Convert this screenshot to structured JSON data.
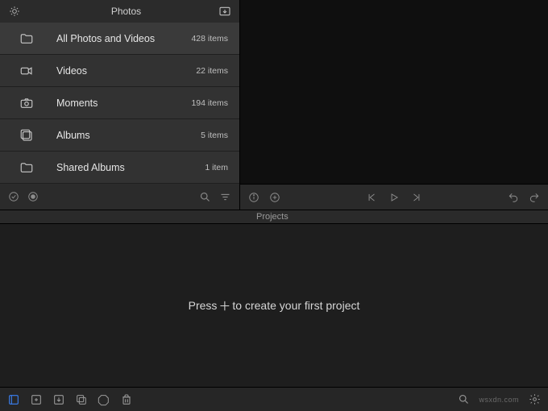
{
  "sidebar": {
    "title": "Photos",
    "items": [
      {
        "label": "All Photos and Videos",
        "count": "428 items",
        "icon": "folder-icon",
        "selected": true
      },
      {
        "label": "Videos",
        "count": "22 items",
        "icon": "video-icon",
        "selected": false
      },
      {
        "label": "Moments",
        "count": "194 items",
        "icon": "camera-icon",
        "selected": false
      },
      {
        "label": "Albums",
        "count": "5 items",
        "icon": "albums-icon",
        "selected": false
      },
      {
        "label": "Shared Albums",
        "count": "1 item",
        "icon": "folder-icon",
        "selected": false
      }
    ]
  },
  "projects": {
    "section_label": "Projects",
    "empty_prefix": "Press ",
    "empty_suffix": " to create your first project"
  },
  "watermark": "wsxdn.com"
}
